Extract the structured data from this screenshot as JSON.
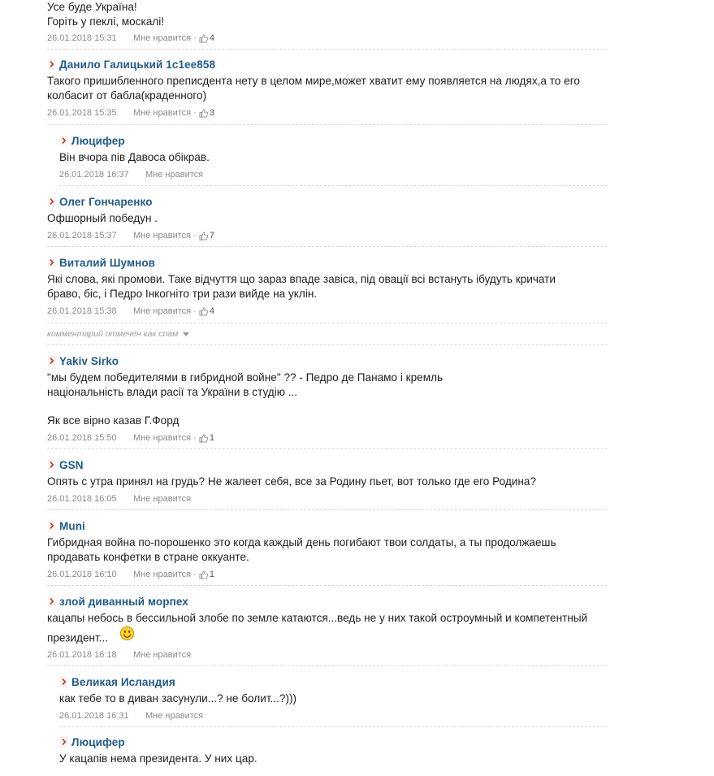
{
  "comments": [
    {
      "author": "",
      "lines": [
        "Усе буде Україна!",
        "Горіть у пеклі, москалі!"
      ],
      "date": "26.01.2018 15:31",
      "like": "Мне нравится",
      "count": "4"
    },
    {
      "author": "Данило Галицький 1c1ee858",
      "lines": [
        "Такого пришибленного преписдента нету в целом мире,может хватит ему появляется на людях,а то его",
        "колбасит от бабла(краденного)"
      ],
      "date": "26.01.2018 15:35",
      "like": "Мне нравится",
      "count": "3"
    },
    {
      "author": "Люцифер",
      "lines": [
        "Він вчора пів Давоса обікрав."
      ],
      "date": "26.01.2018 16:37",
      "like": "Мне нравится"
    },
    {
      "author": "Олег Гончаренко",
      "lines": [
        "Офшорный победун ."
      ],
      "date": "26.01.2018 15:37",
      "like": "Мне нравится",
      "count": "7"
    },
    {
      "author": "Виталий Шумнов",
      "lines": [
        "Які слова, які промови. Таке відчуття що зараз впаде завіса, під овації всі встануть ібудуть кричати",
        "браво, біс, і Педро Інкогніто три рази вийде на уклін."
      ],
      "date": "26.01.2018 15:38",
      "like": "Мне нравится",
      "count": "4"
    },
    {
      "author": "Yakiv Sirko",
      "lines": [
        "\"мы будем победителями в гибридной войне\" ?? - Педро де Панамо і кремль",
        "національність влади расії та України в студію ..."
      ],
      "extra": "Як все вірно казав Г.Форд",
      "date": "26.01.2018 15:50",
      "like": "Мне нравится",
      "count": "1"
    },
    {
      "author": "GSN",
      "lines": [
        "Опять с утра принял на грудь? Не жалеет себя, все за Родину пьет, вот только где его Родина?"
      ],
      "date": "26.01.2018 16:05",
      "like": "Мне нравится"
    },
    {
      "author": "Muni",
      "lines": [
        "Гибридная война по-порошенко это когда каждый день погибают твои солдаты, а ты продолжаешь",
        "продавать конфетки в стране оккуанте."
      ],
      "date": "26.01.2018 16:10",
      "like": "Мне нравится",
      "count": "1"
    },
    {
      "author": "злой диванный морпех",
      "lines": [
        "кацапы небось в бессильной злобе по земле катаются...ведь не у них такой остроумный и компетентный",
        "президент..."
      ],
      "date": "26.01.2018 16:18",
      "like": "Мне нравится"
    },
    {
      "author": "Великая Исландия",
      "lines": [
        "как тебе то в диван засунули...? не болит...?)))"
      ],
      "date": "26.01.2018 16:31",
      "like": "Мне нравится"
    },
    {
      "author": "Люцифер",
      "lines": [
        "У кацапів нема президента. У них цар."
      ]
    }
  ],
  "spam_notice": "комментарий отмечен как спам",
  "icons": {
    "arrow": "chevron-right-icon",
    "thumb": "thumbs-up-icon",
    "smile": "smiley-icon",
    "caret": "caret-down-icon"
  },
  "colors": {
    "author": "#1f5a8a",
    "arrow": "#d9381e",
    "meta": "#8a8a8a"
  }
}
